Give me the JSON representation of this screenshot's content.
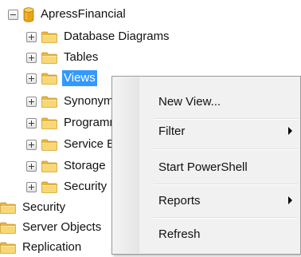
{
  "tree": {
    "database": "ApressFinancial",
    "children": [
      {
        "label": "Database Diagrams"
      },
      {
        "label": "Tables"
      },
      {
        "label": "Views",
        "selected": true
      },
      {
        "label": "Synonyms"
      },
      {
        "label": "Programmability"
      },
      {
        "label": "Service Broker"
      },
      {
        "label": "Storage"
      },
      {
        "label": "Security"
      }
    ],
    "root_items": [
      {
        "label": "Security"
      },
      {
        "label": "Server Objects"
      },
      {
        "label": "Replication"
      }
    ]
  },
  "context_menu": {
    "items": [
      {
        "label": "New View...",
        "submenu": false
      },
      {
        "label": "Filter",
        "submenu": true
      },
      {
        "label": "Start PowerShell",
        "submenu": false
      },
      {
        "label": "Reports",
        "submenu": true
      },
      {
        "label": "Refresh",
        "submenu": false
      }
    ]
  },
  "colors": {
    "selection": "#3399ff",
    "folder": "#e8b53e",
    "database": "#e8a317",
    "menu_bg": "#f1f1f1"
  },
  "icons": {
    "expander_collapsed": "plus-box-icon",
    "expander_expanded": "minus-box-icon",
    "folder": "folder-icon",
    "database": "database-icon",
    "submenu": "submenu-arrow-icon"
  }
}
